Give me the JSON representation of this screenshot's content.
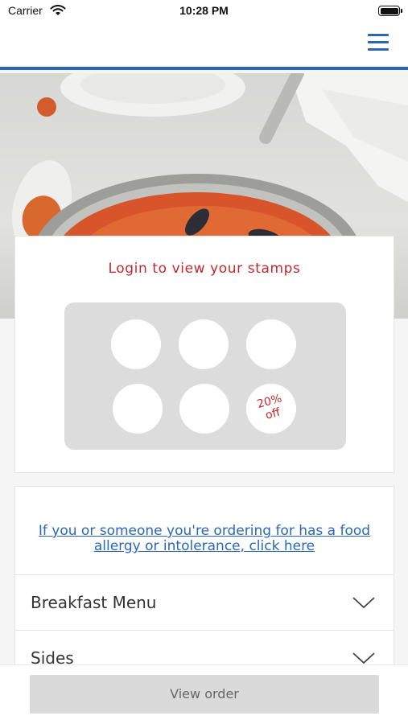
{
  "status_bar": {
    "carrier": "Carrier",
    "time": "10:28 PM"
  },
  "header": {
    "menu_icon": "hamburger-menu-icon"
  },
  "hero": {
    "image": "seafood-paella-photo"
  },
  "stamps": {
    "title": "Login to view your stamps",
    "slots": 6,
    "reward_label": "20%\noff",
    "accent_color": "#c8272e"
  },
  "menu": {
    "allergy_link": "If you or someone you're ordering for has a food allergy or intolerance, click here",
    "sections": [
      {
        "label": "Breakfast Menu",
        "icon": "chevron-down-icon"
      },
      {
        "label": "Sides",
        "icon": "chevron-down-icon"
      }
    ]
  },
  "footer": {
    "view_order_label": "View order"
  },
  "colors": {
    "brand_blue": "#2a67b8",
    "accent_red": "#c8272e",
    "button_gray": "#dadada"
  }
}
